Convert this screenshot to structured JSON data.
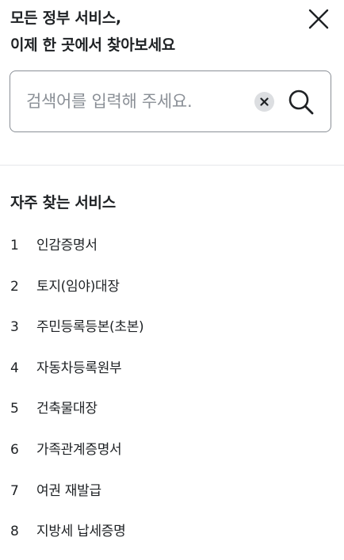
{
  "header": {
    "title_line1": "모든 정부 서비스,",
    "title_line2": "이제 한 곳에서 찾아보세요"
  },
  "search": {
    "placeholder": "검색어를 입력해 주세요.",
    "value": ""
  },
  "popular": {
    "title": "자주 찾는 서비스",
    "items": [
      {
        "rank": "1",
        "label": "인감증명서"
      },
      {
        "rank": "2",
        "label": "토지(임야)대장"
      },
      {
        "rank": "3",
        "label": "주민등록등본(초본)"
      },
      {
        "rank": "4",
        "label": "자동차등록원부"
      },
      {
        "rank": "5",
        "label": "건축물대장"
      },
      {
        "rank": "6",
        "label": "가족관계증명서"
      },
      {
        "rank": "7",
        "label": "여권 재발급"
      },
      {
        "rank": "8",
        "label": "지방세 납세증명"
      }
    ]
  },
  "icons": {
    "close": "close-icon",
    "clear": "clear-icon",
    "search": "search-icon"
  },
  "colors": {
    "text": "#1e2124",
    "placeholder": "#8a8f96",
    "border": "#8a8f96",
    "divider": "#e6e8ea",
    "clear_bg": "#dcdee1"
  }
}
